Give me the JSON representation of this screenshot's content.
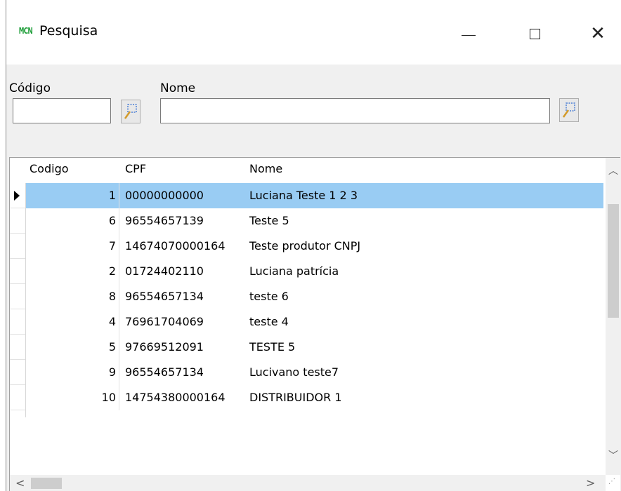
{
  "window": {
    "title": "Pesquisa",
    "app_icon_text": "MCN",
    "icons": {
      "minimize": "minimize-icon",
      "maximize": "maximize-icon",
      "close": "close-icon",
      "search": "search-icon"
    },
    "close_glyph": "✕"
  },
  "filters": {
    "codigo_label": "Código",
    "codigo_value": "",
    "nome_label": "Nome",
    "nome_value": ""
  },
  "grid": {
    "columns": [
      "Codigo",
      "CPF",
      "Nome"
    ],
    "selected_index": 0,
    "rows": [
      {
        "codigo": "1",
        "cpf": "00000000000",
        "nome": "Luciana Teste 1 2 3"
      },
      {
        "codigo": "6",
        "cpf": "96554657139",
        "nome": "Teste 5"
      },
      {
        "codigo": "7",
        "cpf": "14674070000164",
        "nome": "Teste produtor CNPJ"
      },
      {
        "codigo": "2",
        "cpf": "01724402110",
        "nome": "Luciana patrícia"
      },
      {
        "codigo": "8",
        "cpf": "96554657134",
        "nome": "teste 6"
      },
      {
        "codigo": "4",
        "cpf": "76961704069",
        "nome": "teste 4"
      },
      {
        "codigo": "5",
        "cpf": "97669512091",
        "nome": "TESTE 5"
      },
      {
        "codigo": "9",
        "cpf": "96554657134",
        "nome": "Lucivano teste7"
      },
      {
        "codigo": "10",
        "cpf": "14754380000164",
        "nome": "DISTRIBUIDOR 1"
      }
    ]
  },
  "colors": {
    "selection": "#99ccf3",
    "app_icon": "#1f9e3a"
  }
}
